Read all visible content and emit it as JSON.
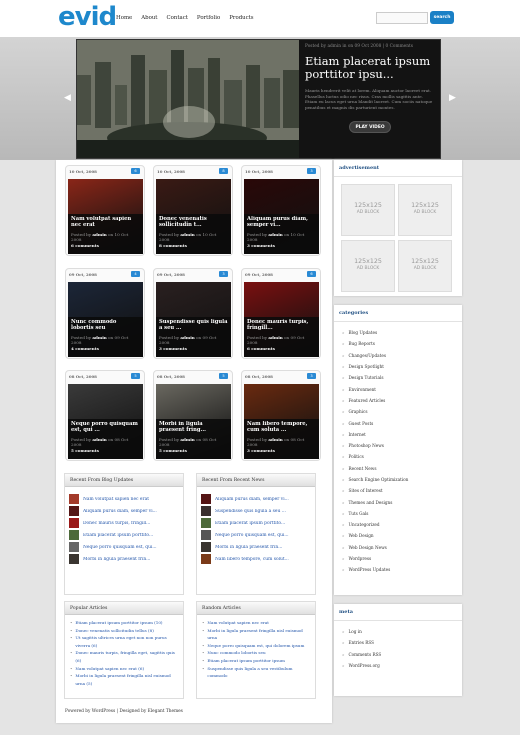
{
  "header": {
    "logo": "evid",
    "nav": [
      "Home",
      "About",
      "Contact",
      "Portfolio",
      "Products"
    ],
    "search_button": "search"
  },
  "featured": {
    "meta": "Posted by admin in on 09 Oct 2008 | 0 Comments",
    "title": "Etiam placerat ipsum porttitor ipsu...",
    "excerpt": "Mauris hendrerit velit at lorem. Aliquam auctor laoreet erat. Phasellus luctus odio nec risus. Cras mollis sagittis ante. Etiam eu lacus eget urna blandit laoreet. Cum sociis natoque penatibus et magnis dis parturient montes.",
    "play_label": "PLAY VIDEO",
    "prev_arrow": "◀",
    "next_arrow": "▶"
  },
  "posts": [
    {
      "date": "10 Oct, 2008",
      "comments_badge": "6",
      "title": "Nam volutpat sapien nec erat",
      "author": "admin",
      "posted_on": "10 Oct 2008",
      "comments": "6 comments",
      "thumb_color": "#8a2618"
    },
    {
      "date": "10 Oct, 2008",
      "comments_badge": "8",
      "title": "Donec venenatis sollicitudin t...",
      "author": "admin",
      "posted_on": "10 Oct 2008",
      "comments": "8 comments",
      "thumb_color": "#3a1a14"
    },
    {
      "date": "10 Oct, 2008",
      "comments_badge": "3",
      "title": "Aliquam purus diam, semper vi...",
      "author": "admin",
      "posted_on": "10 Oct 2008",
      "comments": "3 comments",
      "thumb_color": "#2a0808"
    },
    {
      "date": "09 Oct, 2008",
      "comments_badge": "4",
      "title": "Nunc commodo lobortis seu",
      "author": "admin",
      "posted_on": "09 Oct 2008",
      "comments": "4 comments",
      "thumb_color": "#1c2638"
    },
    {
      "date": "09 Oct, 2008",
      "comments_badge": "3",
      "title": "Suspendisse quis ligula a seu ...",
      "author": "admin",
      "posted_on": "09 Oct 2008",
      "comments": "3 comments",
      "thumb_color": "#2a2020"
    },
    {
      "date": "09 Oct, 2008",
      "comments_badge": "6",
      "title": "Donec mauris turpis, fringill...",
      "author": "admin",
      "posted_on": "09 Oct 2008",
      "comments": "6 comments",
      "thumb_color": "#7a1010"
    },
    {
      "date": "08 Oct, 2008",
      "comments_badge": "5",
      "title": "Neque porro quisquam est, qui ...",
      "author": "admin",
      "posted_on": "08 Oct 2008",
      "comments": "5 comments",
      "thumb_color": "#3a3a3a"
    },
    {
      "date": "08 Oct, 2008",
      "comments_badge": "5",
      "title": "Morbi in ligula praesent fring...",
      "author": "admin",
      "posted_on": "08 Oct 2008",
      "comments": "5 comments",
      "thumb_color": "#6a6860"
    },
    {
      "date": "08 Oct, 2008",
      "comments_badge": "3",
      "title": "Nam libero tempore, cum soluta ...",
      "author": "admin",
      "posted_on": "08 Oct 2008",
      "comments": "3 comments",
      "thumb_color": "#6a2a10"
    }
  ],
  "recent_blog": {
    "title": "Recent From Blog Updates",
    "items": [
      {
        "text": "Nam volutpat sapien nec erat",
        "color": "#a33a2a"
      },
      {
        "text": "Aliquam purus diam, semper vi...",
        "color": "#551515"
      },
      {
        "text": "Donec mauris turpis, fringill...",
        "color": "#9a1818"
      },
      {
        "text": "Etiam placerat ipsum porttito...",
        "color": "#4d6a3a"
      },
      {
        "text": "Neque porro quisquam est, qui...",
        "color": "#666666"
      },
      {
        "text": "Morbi in ligula praesent frin...",
        "color": "#3a3530"
      }
    ]
  },
  "recent_news": {
    "title": "Recent From Recent News",
    "items": [
      {
        "text": "Aliquam purus diam, semper vi...",
        "color": "#551515"
      },
      {
        "text": "Suspendisse quis ligula a seu ...",
        "color": "#3a3030"
      },
      {
        "text": "Etiam placerat ipsum porttito...",
        "color": "#4d6a3a"
      },
      {
        "text": "Neque porro quisquam est, qui...",
        "color": "#555555"
      },
      {
        "text": "Morbi in ligula praesent frin...",
        "color": "#3a3530"
      },
      {
        "text": "Nam libero tempore, cum solut...",
        "color": "#7a3a18"
      }
    ]
  },
  "popular": {
    "title": "Popular Articles",
    "items": [
      "Etiam placerat ipsum porttitor ipsum (10)",
      "Donec venenatis sollicitudin tellus (8)",
      "Ut sagittis ultrices urna eget non non purus viverra (6)",
      "Donec mauris turpis, fringilla eget, sagittis quis (6)",
      "Nam volutpat sapien nec erat (6)",
      "Morbi in ligula praesent fringilla nisl euismod urna (5)"
    ]
  },
  "random": {
    "title": "Random Articles",
    "items": [
      "Nam volutpat sapien nec erat",
      "Morbi in ligula praesent fringilla nisl euismod urna",
      "Neque porro quisquam est, qui dolorem ipsum",
      "Nunc commodo lobortis seu",
      "Etiam placerat ipsum porttitor ipsum",
      "Suspendisse quis ligula a seu vestibulum commodo"
    ]
  },
  "footer": "Powered by WordPress | Designed by Elegant Themes",
  "sidebar": {
    "ad_title": "advertisement",
    "ad_size": "125x125",
    "ad_text": "AD BLOCK",
    "cat_title": "categories",
    "categories": [
      "Blog Updates",
      "Bug Reports",
      "Changes/Updates",
      "Design Spotlight",
      "Design Tutorials",
      "Environment",
      "Featured Articles",
      "Graphics",
      "Guest Posts",
      "Internet",
      "Photoshop News",
      "Politics",
      "Recent News",
      "Search Engine Optimization",
      "Sites of Interest",
      "Themes and Designs",
      "Tuts Gals",
      "Uncategorized",
      "Web Design",
      "Web Design News",
      "Wordpress",
      "WordPress Updates"
    ],
    "meta_title": "meta",
    "meta_items": [
      "Log in",
      "Entries RSS",
      "Comments RSS",
      "WordPress.org"
    ]
  }
}
